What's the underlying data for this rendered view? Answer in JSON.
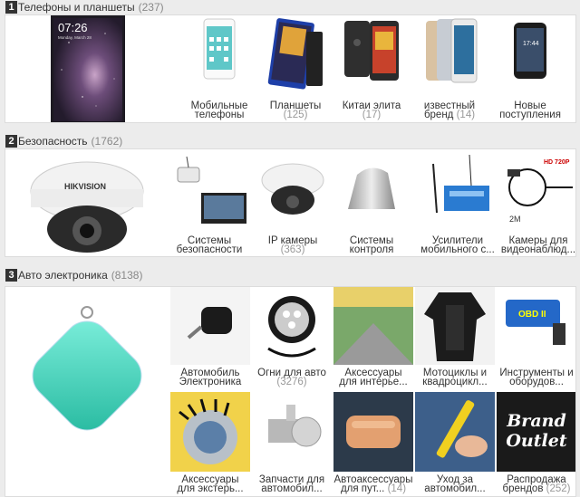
{
  "sections": [
    {
      "num": "1",
      "title": "Телефоны и планшеты",
      "count": "(237)",
      "items": [
        {
          "l1": "Мобильные",
          "l2": "телефоны",
          "count": ""
        },
        {
          "l1": "Планшеты",
          "l2": "",
          "count": "(125)"
        },
        {
          "l1": "Китаи элита",
          "l2": "",
          "count": "(17)"
        },
        {
          "l1": "известный",
          "l2": "бренд",
          "count": "(14)"
        },
        {
          "l1": "Новые",
          "l2": "поступления",
          "count": ""
        }
      ]
    },
    {
      "num": "2",
      "title": "Безопасность",
      "count": "(1762)",
      "items": [
        {
          "l1": "Системы",
          "l2": "безопасности",
          "count": ""
        },
        {
          "l1": "IP камеры",
          "l2": "",
          "count": "(363)"
        },
        {
          "l1": "Системы",
          "l2": "контроля",
          "count": ""
        },
        {
          "l1": "Усилители",
          "l2": "мобильного с...",
          "count": ""
        },
        {
          "l1": "Камеры для",
          "l2": "видеонаблюд...",
          "count": ""
        }
      ]
    },
    {
      "num": "3",
      "title": "Авто электроника",
      "count": "(8138)",
      "items": [
        {
          "l1": "Автомобиль",
          "l2": "Электроника",
          "count": ""
        },
        {
          "l1": "Огни для авто",
          "l2": "",
          "count": "(3276)"
        },
        {
          "l1": "Аксессуары",
          "l2": "для интерье...",
          "count": ""
        },
        {
          "l1": "Мотоциклы и",
          "l2": "квадроцикл...",
          "count": ""
        },
        {
          "l1": "Инструменты и",
          "l2": "оборудов...",
          "count": ""
        },
        {
          "l1": "Аксессуары",
          "l2": "для экстерь...",
          "count": ""
        },
        {
          "l1": "Запчасти для",
          "l2": "автомобил...",
          "count": ""
        },
        {
          "l1": "Автоаксессуары",
          "l2": "для пут...",
          "count": "(14)"
        },
        {
          "l1": "Уход за",
          "l2": "автомобил...",
          "count": ""
        },
        {
          "l1": "Распродажа",
          "l2": "брендов",
          "count": "(252)"
        }
      ]
    }
  ],
  "phone_screen": {
    "time": "07:26",
    "date": "Monday, March 28"
  },
  "brand_text": {
    "hikvision": "HIKVISION",
    "brand": "Brand",
    "outlet": "Outlet",
    "obd": "OBD II",
    "hd": "HD 720P",
    "twom": "2M"
  },
  "colors": {
    "accent": "#333333",
    "count_gray": "#999999",
    "tracker_teal": "#3fd9c0",
    "security_camera_white": "#f2f2f2"
  }
}
